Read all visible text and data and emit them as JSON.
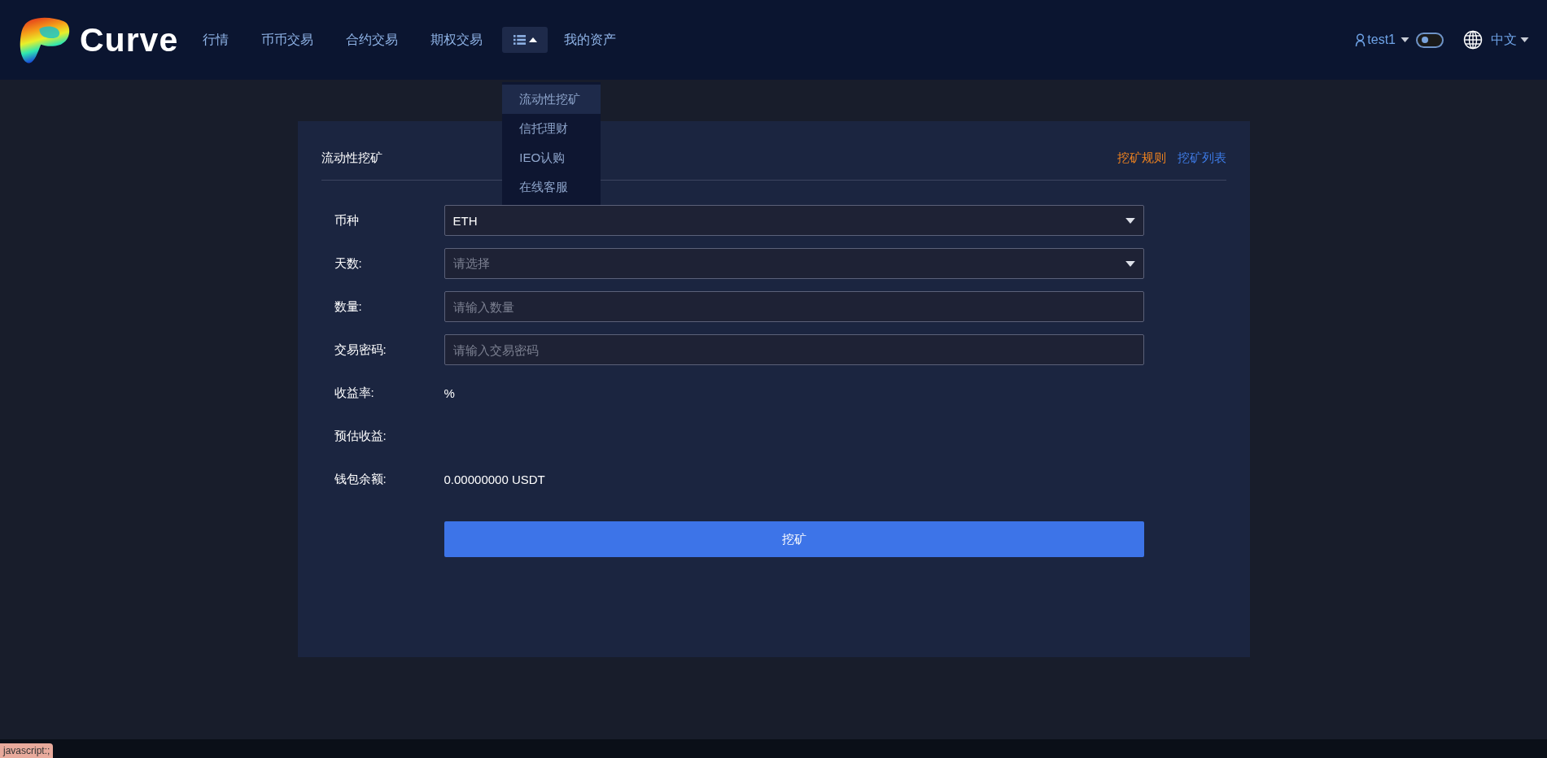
{
  "header": {
    "logo_text": "Curve",
    "nav": [
      {
        "kind": "link",
        "label": "行情"
      },
      {
        "kind": "link",
        "label": "币币交易"
      },
      {
        "kind": "link",
        "label": "合约交易"
      },
      {
        "kind": "link",
        "label": "期权交易"
      },
      {
        "kind": "menu",
        "expanded": true
      },
      {
        "kind": "link",
        "label": "我的资产"
      }
    ],
    "user": "test1",
    "theme_toggle": {
      "on": false
    },
    "language": "中文"
  },
  "menu_dropdown": [
    {
      "label": "流动性挖矿",
      "selected": true
    },
    {
      "label": "信托理财",
      "selected": false
    },
    {
      "label": "IEO认购",
      "selected": false
    },
    {
      "label": "在线客服",
      "selected": false
    }
  ],
  "card": {
    "title": "流动性挖矿",
    "links": [
      {
        "label": "挖矿规则",
        "color": "#f0831f"
      },
      {
        "label": "挖矿列表",
        "color": "#3d7be6"
      }
    ],
    "form": [
      {
        "kind": "select",
        "label": "币种",
        "value": "ETH"
      },
      {
        "kind": "select",
        "label": "天数:",
        "placeholder": "请选择"
      },
      {
        "kind": "input",
        "label": "数量:",
        "placeholder": "请输入数量"
      },
      {
        "kind": "input",
        "label": "交易密码:",
        "placeholder": "请输入交易密码"
      },
      {
        "kind": "text",
        "label": "收益率:",
        "value": "%"
      },
      {
        "kind": "text",
        "label": "预估收益:"
      },
      {
        "kind": "text",
        "label": "钱包余额:",
        "value": "0.00000000 USDT"
      }
    ],
    "submit": "挖矿"
  },
  "status_tooltip": "javascript:;"
}
